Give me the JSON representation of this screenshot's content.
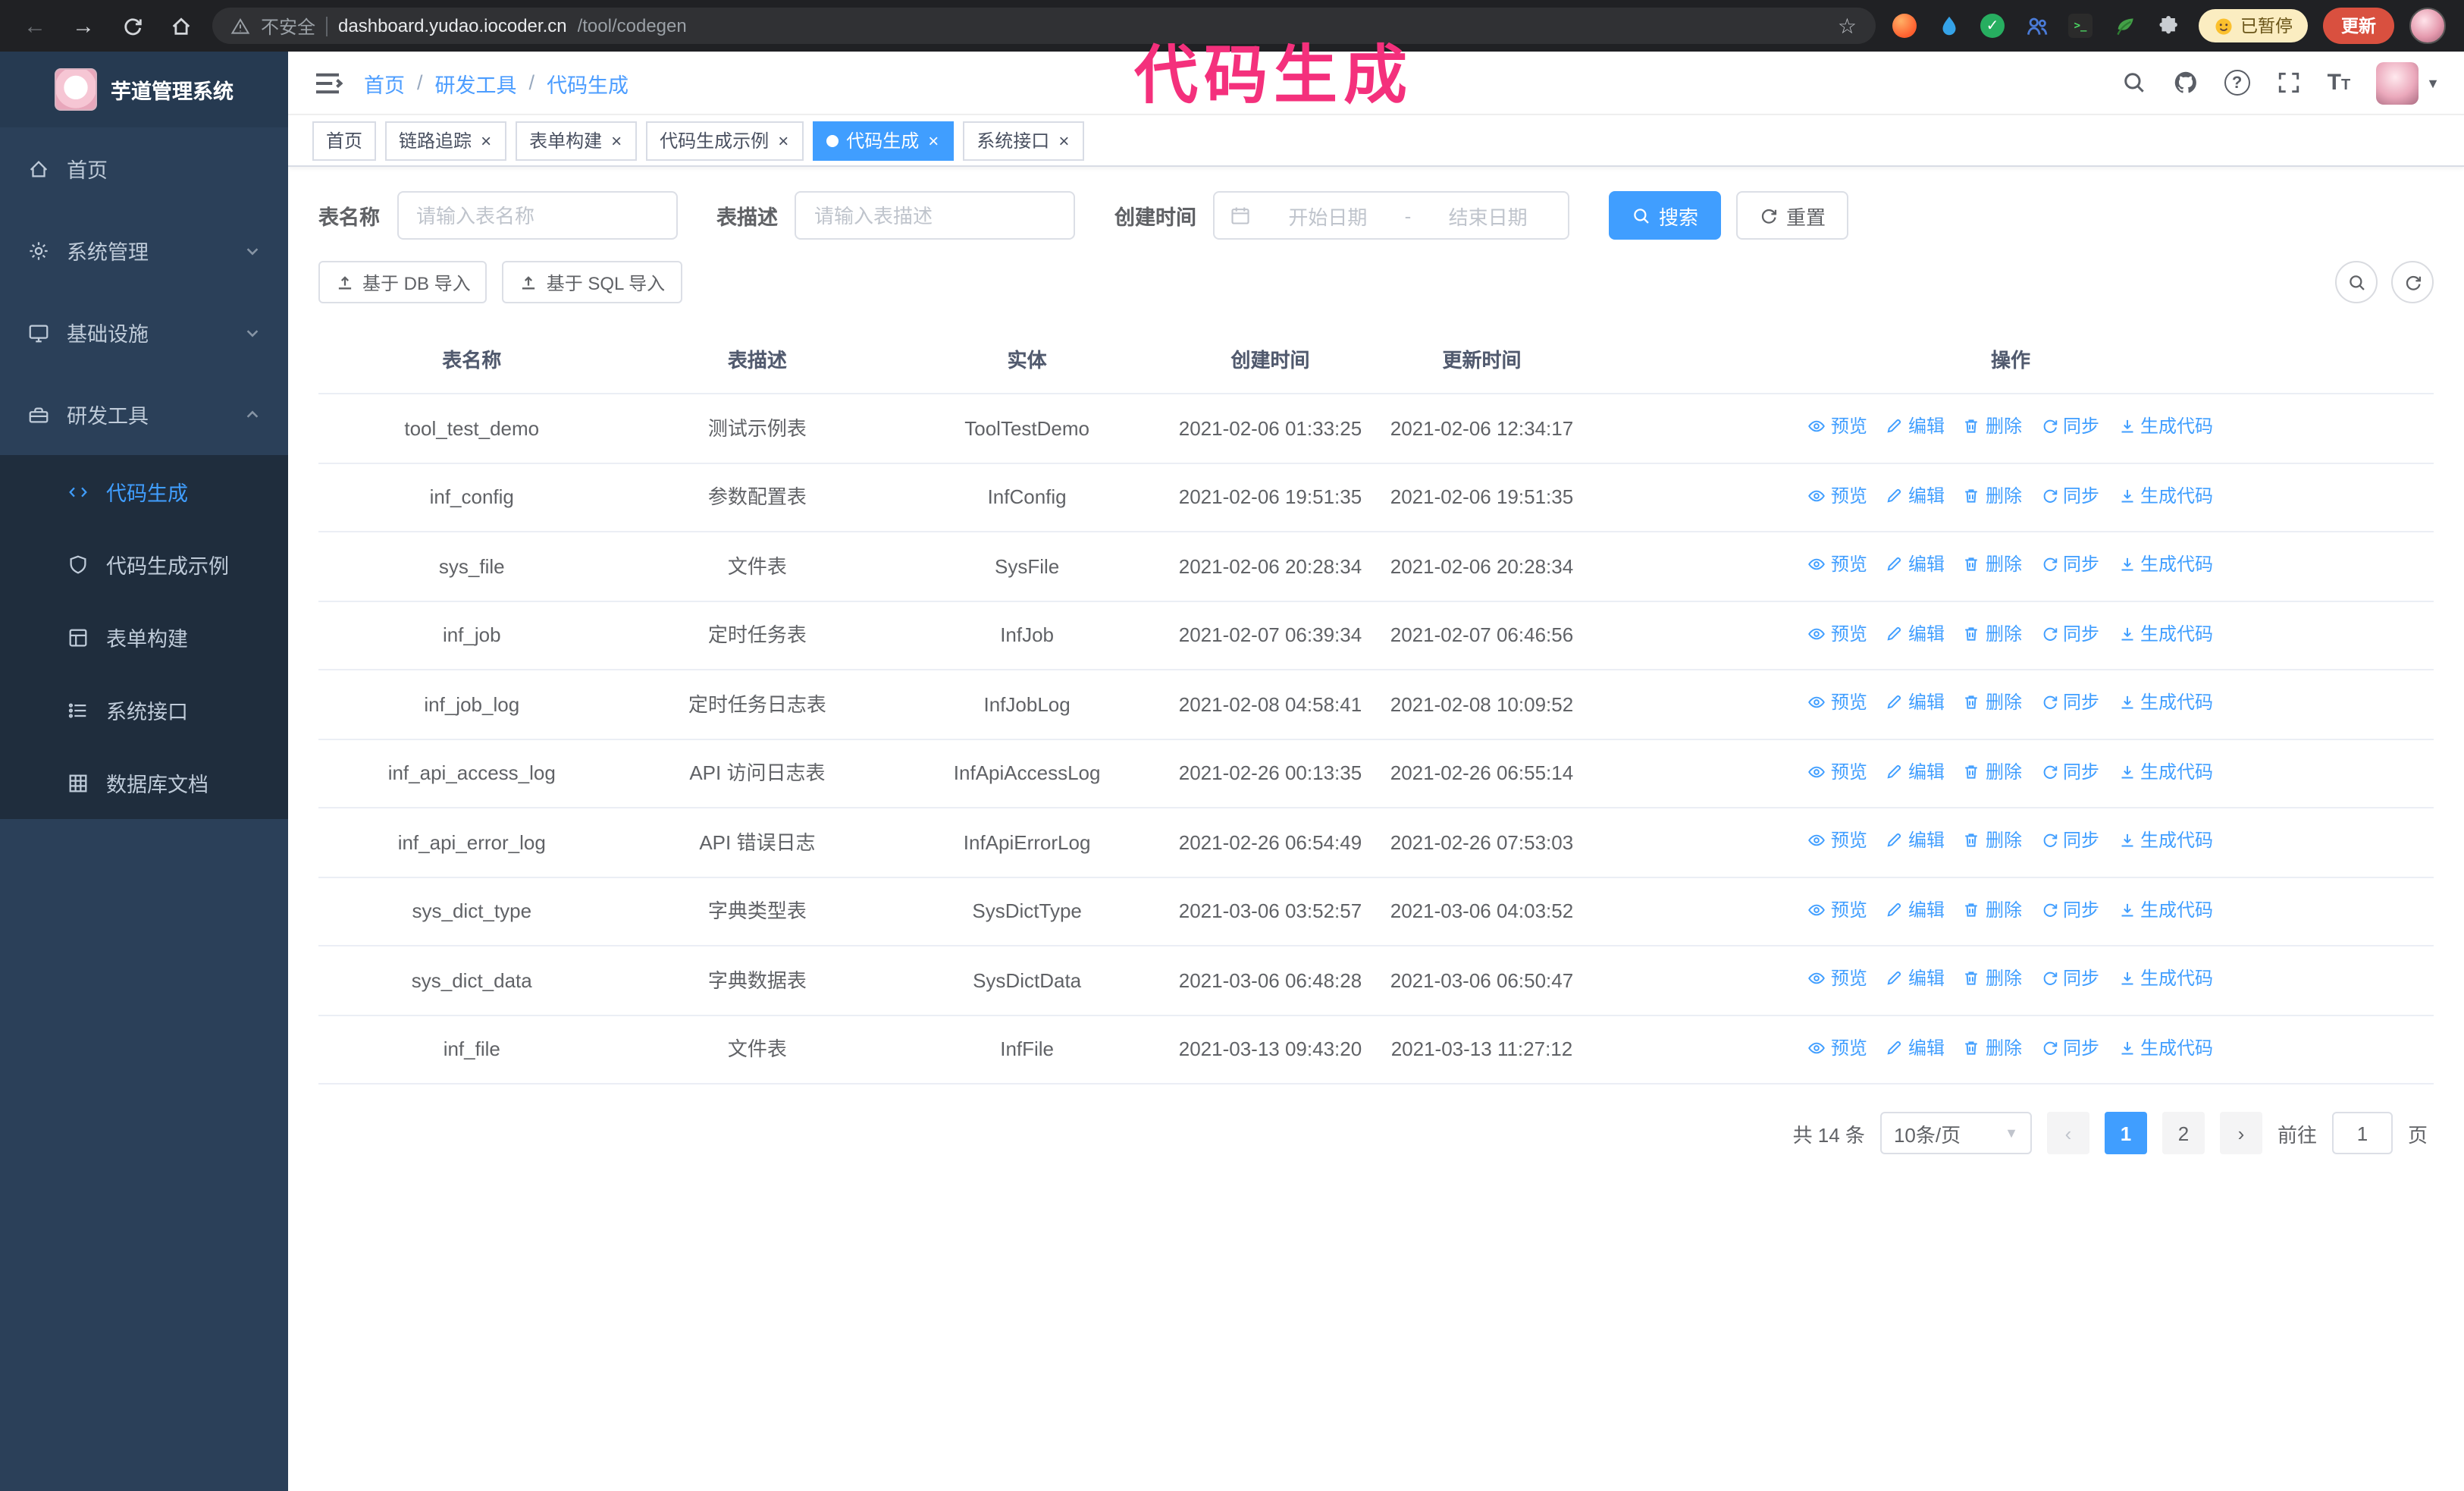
{
  "chrome": {
    "security_label": "不安全",
    "url_host": "dashboard.yudao.iocoder.cn",
    "url_path": "/tool/codegen",
    "paused_badge": "已暂停",
    "update_button": "更新"
  },
  "annotation": "代码生成",
  "sidebar": {
    "logo_title": "芋道管理系统",
    "items": [
      {
        "label": "首页"
      },
      {
        "label": "系统管理"
      },
      {
        "label": "基础设施"
      },
      {
        "label": "研发工具"
      }
    ],
    "sub_items": [
      {
        "label": "代码生成"
      },
      {
        "label": "代码生成示例"
      },
      {
        "label": "表单构建"
      },
      {
        "label": "系统接口"
      },
      {
        "label": "数据库文档"
      }
    ]
  },
  "breadcrumb": {
    "items": [
      "首页",
      "研发工具",
      "代码生成"
    ],
    "separator": "/"
  },
  "tabs": [
    {
      "label": "首页"
    },
    {
      "label": "链路追踪"
    },
    {
      "label": "表单构建"
    },
    {
      "label": "代码生成示例"
    },
    {
      "label": "代码生成"
    },
    {
      "label": "系统接口"
    }
  ],
  "filters": {
    "table_name_label": "表名称",
    "table_name_placeholder": "请输入表名称",
    "table_desc_label": "表描述",
    "table_desc_placeholder": "请输入表描述",
    "create_time_label": "创建时间",
    "date_start_placeholder": "开始日期",
    "date_separator": "-",
    "date_end_placeholder": "结束日期",
    "search_button": "搜索",
    "reset_button": "重置"
  },
  "toolbar": {
    "import_db": "基于 DB 导入",
    "import_sql": "基于 SQL 导入"
  },
  "table": {
    "columns": [
      "表名称",
      "表描述",
      "实体",
      "创建时间",
      "更新时间",
      "操作"
    ],
    "actions": [
      {
        "key": "preview",
        "label": "预览"
      },
      {
        "key": "edit",
        "label": "编辑"
      },
      {
        "key": "delete",
        "label": "删除"
      },
      {
        "key": "sync",
        "label": "同步"
      },
      {
        "key": "generate",
        "label": "生成代码"
      }
    ],
    "rows": [
      {
        "name": "tool_test_demo",
        "desc": "测试示例表",
        "entity": "ToolTestDemo",
        "created": "2021-02-06 01:33:25",
        "updated": "2021-02-06 12:34:17"
      },
      {
        "name": "inf_config",
        "desc": "参数配置表",
        "entity": "InfConfig",
        "created": "2021-02-06 19:51:35",
        "updated": "2021-02-06 19:51:35"
      },
      {
        "name": "sys_file",
        "desc": "文件表",
        "entity": "SysFile",
        "created": "2021-02-06 20:28:34",
        "updated": "2021-02-06 20:28:34"
      },
      {
        "name": "inf_job",
        "desc": "定时任务表",
        "entity": "InfJob",
        "created": "2021-02-07 06:39:34",
        "updated": "2021-02-07 06:46:56"
      },
      {
        "name": "inf_job_log",
        "desc": "定时任务日志表",
        "entity": "InfJobLog",
        "created": "2021-02-08 04:58:41",
        "updated": "2021-02-08 10:09:52"
      },
      {
        "name": "inf_api_access_log",
        "desc": "API 访问日志表",
        "entity": "InfApiAccessLog",
        "created": "2021-02-26 00:13:35",
        "updated": "2021-02-26 06:55:14"
      },
      {
        "name": "inf_api_error_log",
        "desc": "API 错误日志",
        "entity": "InfApiErrorLog",
        "created": "2021-02-26 06:54:49",
        "updated": "2021-02-26 07:53:03"
      },
      {
        "name": "sys_dict_type",
        "desc": "字典类型表",
        "entity": "SysDictType",
        "created": "2021-03-06 03:52:57",
        "updated": "2021-03-06 04:03:52"
      },
      {
        "name": "sys_dict_data",
        "desc": "字典数据表",
        "entity": "SysDictData",
        "created": "2021-03-06 06:48:28",
        "updated": "2021-03-06 06:50:47"
      },
      {
        "name": "inf_file",
        "desc": "文件表",
        "entity": "InfFile",
        "created": "2021-03-13 09:43:20",
        "updated": "2021-03-13 11:27:12"
      }
    ]
  },
  "pagination": {
    "total": "共 14 条",
    "page_size": "10条/页",
    "pages": [
      "1",
      "2"
    ],
    "goto_label": "前往",
    "goto_value": "1",
    "goto_suffix": "页"
  }
}
